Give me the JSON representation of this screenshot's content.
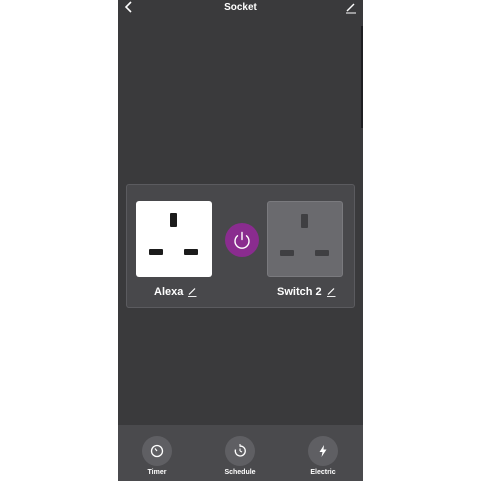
{
  "header": {
    "title": "Socket",
    "back_icon": "chevron-left-icon",
    "edit_icon": "pencil-icon"
  },
  "sockets": [
    {
      "label": "Alexa",
      "state": "on",
      "edit_icon": "pencil-icon"
    },
    {
      "label": "Switch 2",
      "state": "off",
      "edit_icon": "pencil-icon"
    }
  ],
  "power_button": {
    "icon": "power-icon",
    "color": "#8a2c8f"
  },
  "bottom_tabs": [
    {
      "label": "Timer",
      "icon": "timer-icon"
    },
    {
      "label": "Schedule",
      "icon": "schedule-icon"
    },
    {
      "label": "Electric",
      "icon": "lightning-icon"
    }
  ],
  "colors": {
    "background": "#3a3a3c",
    "panel": "#48484b",
    "accent": "#8a2c8f"
  }
}
